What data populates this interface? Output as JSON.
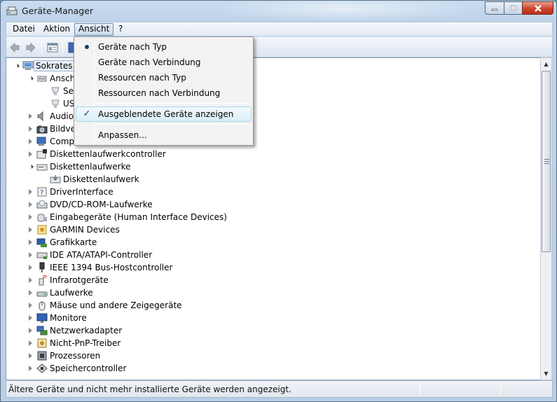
{
  "window": {
    "title": "Geräte-Manager"
  },
  "menu": {
    "items": [
      "Datei",
      "Aktion",
      "Ansicht",
      "?"
    ],
    "active": "Ansicht"
  },
  "toolbar": {
    "icons": [
      "back-arrow-icon",
      "forward-arrow-icon",
      "properties-icon",
      "help-icon"
    ]
  },
  "tree": {
    "root": "Sokrates",
    "nodes": [
      {
        "label": "Anschlüsse",
        "visible_label": "Ansch",
        "expanded": true
      },
      {
        "label": "Se"
      },
      {
        "label": "US"
      },
      {
        "label": "Audio"
      },
      {
        "label": "Bildve"
      },
      {
        "label": "Comp"
      },
      {
        "label": "Diskettenlaufwerkcontroller"
      },
      {
        "label": "Diskettenlaufwerke",
        "expanded": true
      },
      {
        "label": "Diskettenlaufwerk"
      },
      {
        "label": "DriverInterface"
      },
      {
        "label": "DVD/CD-ROM-Laufwerke"
      },
      {
        "label": "Eingabegeräte (Human Interface Devices)"
      },
      {
        "label": "GARMIN Devices"
      },
      {
        "label": "Grafikkarte"
      },
      {
        "label": "IDE ATA/ATAPI-Controller"
      },
      {
        "label": "IEEE 1394 Bus-Hostcontroller"
      },
      {
        "label": "Infrarotgeräte"
      },
      {
        "label": "Laufwerke"
      },
      {
        "label": "Mäuse und andere Zeigegeräte"
      },
      {
        "label": "Monitore"
      },
      {
        "label": "Netzwerkadapter"
      },
      {
        "label": "Nicht-PnP-Treiber"
      },
      {
        "label": "Prozessoren"
      },
      {
        "label": "Speichercontroller"
      }
    ]
  },
  "dropdown": {
    "items": [
      {
        "label": "Geräte nach Typ",
        "mark": "bullet"
      },
      {
        "label": "Geräte nach Verbindung"
      },
      {
        "label": "Ressourcen nach Typ"
      },
      {
        "label": "Ressourcen nach Verbindung"
      },
      {
        "label": "Ausgeblendete Geräte anzeigen",
        "mark": "check",
        "highlighted": true
      },
      {
        "label": "Anpassen..."
      }
    ]
  },
  "status": {
    "text": "Ältere Geräte und nicht mehr installierte Geräte werden angezeigt."
  },
  "colors": {
    "menu_highlight": "#dbeef8",
    "selection": "#e9f0f9",
    "close_button": "#c9452c"
  }
}
